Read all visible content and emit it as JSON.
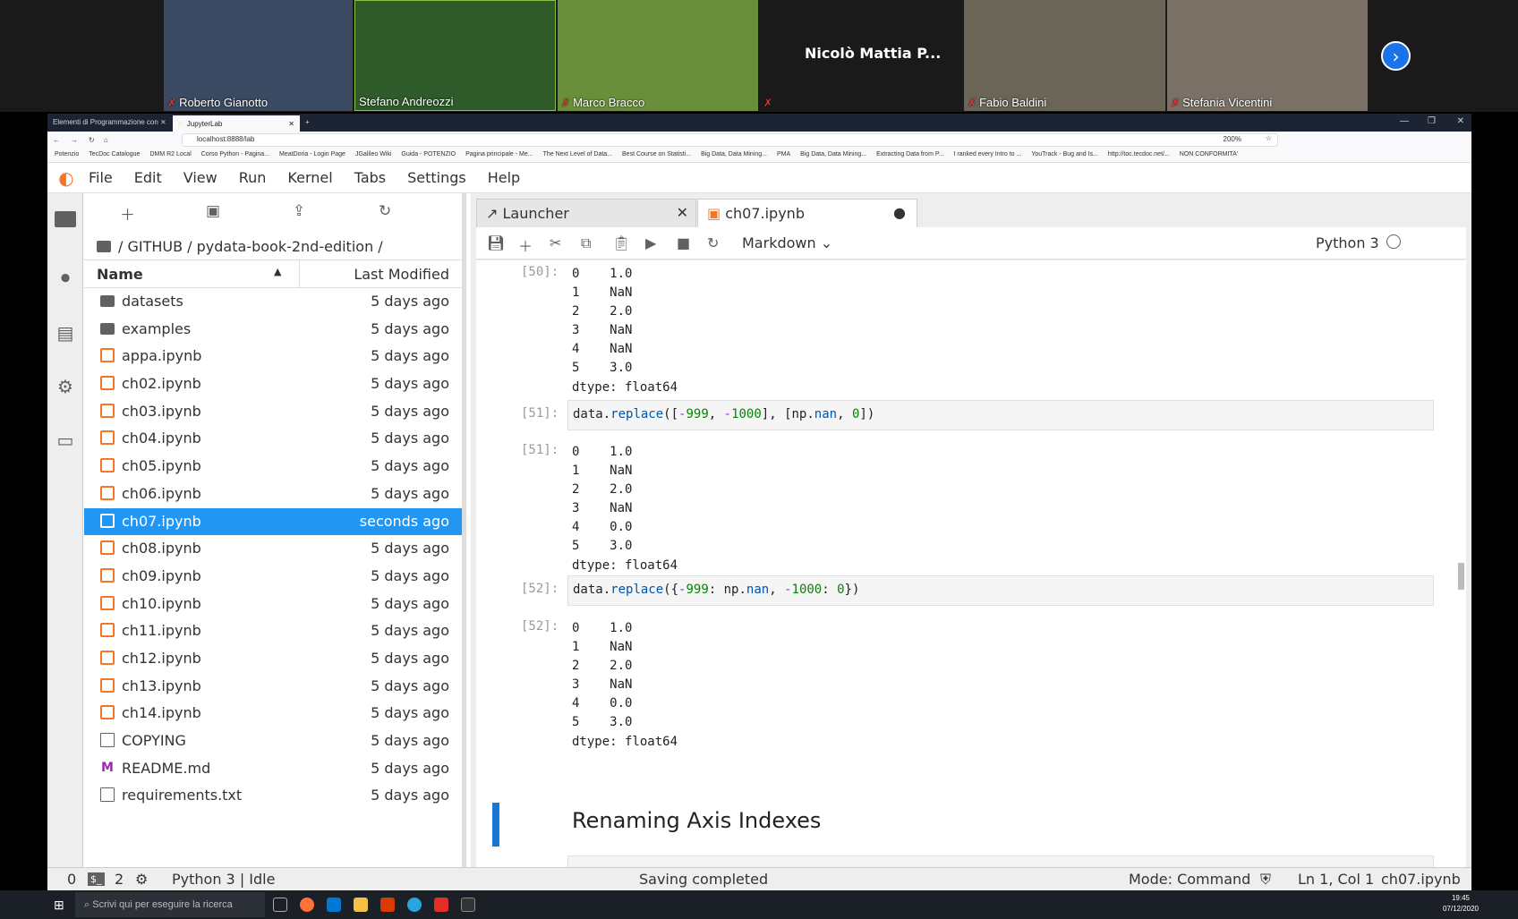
{
  "participants": [
    {
      "name": "Roberto Gianotto",
      "bg": "#3a4a62"
    },
    {
      "name": "Stefano Andreozzi",
      "bg": "#2f5a2a"
    },
    {
      "name": "Marco Bracco",
      "bg": "#6a8f3a"
    },
    {
      "name": "Nicolò Mattia P...",
      "bg": "#1a1a1a"
    },
    {
      "name": "Fabio Baldini",
      "bg": "#6b6558"
    },
    {
      "name": "Stefania Vicentini",
      "bg": "#7a7066"
    }
  ],
  "browser": {
    "tabs": [
      "Elementi di Programmazione con ⨯",
      "JupyterLab"
    ],
    "url": "localhost:8888/lab",
    "zoom": "200%",
    "bookmarks": [
      "Potenzio",
      "TecDoc Catalogue",
      "DMM R2 Local",
      "Corso Python - Pagina...",
      "MeatDoria - Login Page",
      "JGalileo Wiki",
      "Guida - POTENZIO",
      "Pagina principale - Me...",
      "The Next Level of Data...",
      "Best Course on Statisti...",
      "Big Data, Data Mining...",
      "PMA",
      "Big Data, Data Mining...",
      "Extracting Data from P...",
      "I ranked every Intro to ...",
      "YouTrack - Bug and Is...",
      "http://toc.tecdoc.net/...",
      "NON CONFORMITA'"
    ]
  },
  "menu": [
    "File",
    "Edit",
    "View",
    "Run",
    "Kernel",
    "Tabs",
    "Settings",
    "Help"
  ],
  "filebrowser": {
    "breadcrumb": "/ GITHUB / pydata-book-2nd-edition /",
    "col_name": "Name",
    "col_modified": "Last Modified",
    "files": [
      {
        "name": "datasets",
        "type": "folder",
        "modified": "5 days ago"
      },
      {
        "name": "examples",
        "type": "folder",
        "modified": "5 days ago"
      },
      {
        "name": "appa.ipynb",
        "type": "nb",
        "modified": "5 days ago"
      },
      {
        "name": "ch02.ipynb",
        "type": "nb",
        "modified": "5 days ago"
      },
      {
        "name": "ch03.ipynb",
        "type": "nb",
        "modified": "5 days ago"
      },
      {
        "name": "ch04.ipynb",
        "type": "nb",
        "modified": "5 days ago"
      },
      {
        "name": "ch05.ipynb",
        "type": "nb",
        "modified": "5 days ago"
      },
      {
        "name": "ch06.ipynb",
        "type": "nb",
        "modified": "5 days ago"
      },
      {
        "name": "ch07.ipynb",
        "type": "nb",
        "modified": "seconds ago",
        "selected": true
      },
      {
        "name": "ch08.ipynb",
        "type": "nb",
        "modified": "5 days ago"
      },
      {
        "name": "ch09.ipynb",
        "type": "nb",
        "modified": "5 days ago"
      },
      {
        "name": "ch10.ipynb",
        "type": "nb",
        "modified": "5 days ago"
      },
      {
        "name": "ch11.ipynb",
        "type": "nb",
        "modified": "5 days ago"
      },
      {
        "name": "ch12.ipynb",
        "type": "nb",
        "modified": "5 days ago"
      },
      {
        "name": "ch13.ipynb",
        "type": "nb",
        "modified": "5 days ago"
      },
      {
        "name": "ch14.ipynb",
        "type": "nb",
        "modified": "5 days ago"
      },
      {
        "name": "COPYING",
        "type": "file",
        "modified": "5 days ago"
      },
      {
        "name": "README.md",
        "type": "md",
        "modified": "5 days ago"
      },
      {
        "name": "requirements.txt",
        "type": "file",
        "modified": "5 days ago"
      }
    ]
  },
  "notebook": {
    "tabs": [
      "Launcher",
      "ch07.ipynb"
    ],
    "cell_type": "Markdown",
    "kernel": "Python 3",
    "out50_prompt": "[50]:",
    "out50": "0    1.0\n1    NaN\n2    2.0\n3    NaN\n4    NaN\n5    3.0\ndtype: float64",
    "in51_prompt": "[51]:",
    "out51_prompt": "[51]:",
    "out51": "0    1.0\n1    NaN\n2    2.0\n3    NaN\n4    0.0\n5    3.0\ndtype: float64",
    "in52_prompt": "[52]:",
    "out52_prompt": "[52]:",
    "out52": "0    1.0\n1    NaN\n2    2.0\n3    NaN\n4    0.0\n5    3.0\ndtype: float64",
    "heading": "Renaming Axis Indexes"
  },
  "status": {
    "terminals": "0",
    "kernels": "2",
    "kernel_state": "Python 3 | Idle",
    "message": "Saving completed",
    "mode": "Mode: Command",
    "position": "Ln 1, Col 1",
    "file": "ch07.ipynb"
  },
  "taskbar": {
    "search": "Scrivi qui per eseguire la ricerca",
    "time": "19:45",
    "date": "07/12/2020"
  }
}
